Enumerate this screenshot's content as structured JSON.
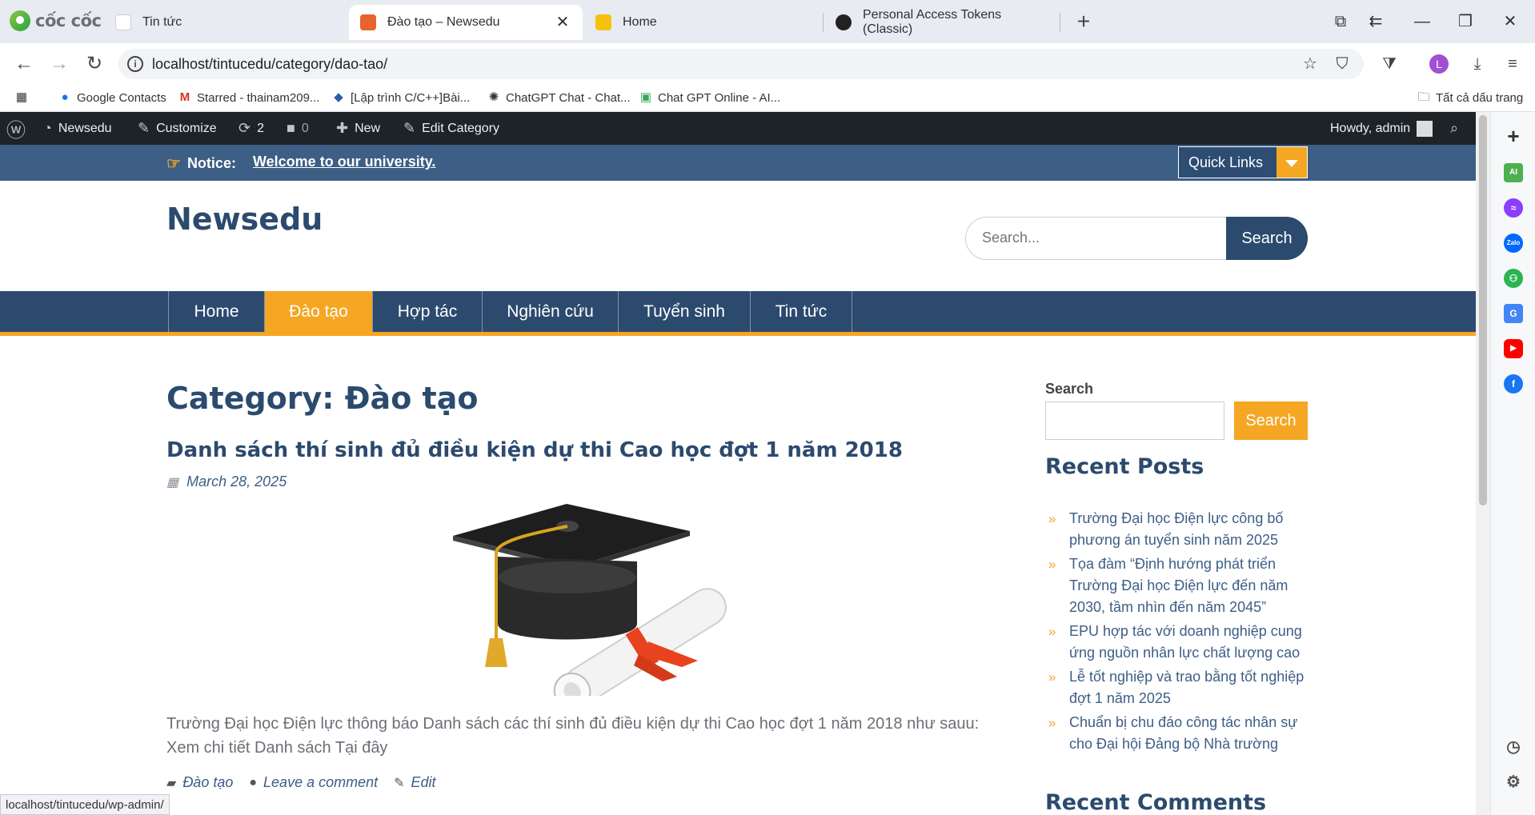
{
  "browser": {
    "logo_text": "cốc cốc",
    "tabs": [
      {
        "title": "Tin tức"
      },
      {
        "title": "Đào tạo – Newsedu"
      },
      {
        "title": "Home"
      },
      {
        "title": "Personal Access Tokens (Classic)"
      }
    ],
    "url": "localhost/tintucedu/category/dao-tao/",
    "bookmarks": [
      {
        "label": "Google Contacts"
      },
      {
        "label": "Starred - thainam209..."
      },
      {
        "label": "[Lập trình C/C++]Bài..."
      },
      {
        "label": "ChatGPT Chat - Chat..."
      },
      {
        "label": "Chat GPT Online - AI..."
      }
    ],
    "all_bookmarks": "Tất cả dấu trang",
    "profile_initial": "L",
    "status_url": "localhost/tintucedu/wp-admin/"
  },
  "admin_bar": {
    "site": "Newsedu",
    "customize": "Customize",
    "updates": "2",
    "comments": "0",
    "new": "New",
    "edit_category": "Edit Category",
    "howdy": "Howdy, admin"
  },
  "notice": {
    "label": "Notice:",
    "text": "Welcome to our university.",
    "quick_links": "Quick Links"
  },
  "header": {
    "site_title": "Newsedu",
    "search_placeholder": "Search...",
    "search_button": "Search"
  },
  "nav": [
    {
      "label": "Home"
    },
    {
      "label": "Đào tạo"
    },
    {
      "label": "Hợp tác"
    },
    {
      "label": "Nghiên cứu"
    },
    {
      "label": "Tuyển sinh"
    },
    {
      "label": "Tin tức"
    }
  ],
  "main": {
    "category_title": "Category: Đào tạo",
    "post": {
      "title": "Danh sách thí sinh đủ điều kiện dự thi Cao học đợt 1 năm 2018",
      "date": "March 28, 2025",
      "excerpt": "Trường Đại học Điện lực thông báo Danh sách các thí sinh đủ điều kiện dự thi Cao học đợt 1 năm 2018 như sauu: Xem chi tiết Danh sách Tại đây",
      "category": "Đào tạo",
      "comment_link": "Leave a comment",
      "edit_link": "Edit"
    }
  },
  "sidebar": {
    "search_label": "Search",
    "search_button": "Search",
    "recent_posts_title": "Recent Posts",
    "recent_posts": [
      "Trường Đại học Điện lực công bố phương án tuyển sinh năm 2025",
      "Tọa đàm “Định hướng phát triển Trường Đại học Điện lực đến năm 2030, tầm nhìn đến năm 2045”",
      "EPU hợp tác với doanh nghiệp cung ứng nguồn nhân lực chất lượng cao",
      "Lễ tốt nghiệp và trao bằng tốt nghiệp đợt 1 năm 2025",
      "Chuẩn bị chu đáo công tác nhân sự cho Đại hội Đảng bộ Nhà trường"
    ],
    "recent_comments_title": "Recent Comments"
  },
  "colors": {
    "primary": "#2b4a6e",
    "accent": "#f5a623",
    "admin_bar": "#1d2327",
    "notice_bar": "#3d5e85"
  }
}
